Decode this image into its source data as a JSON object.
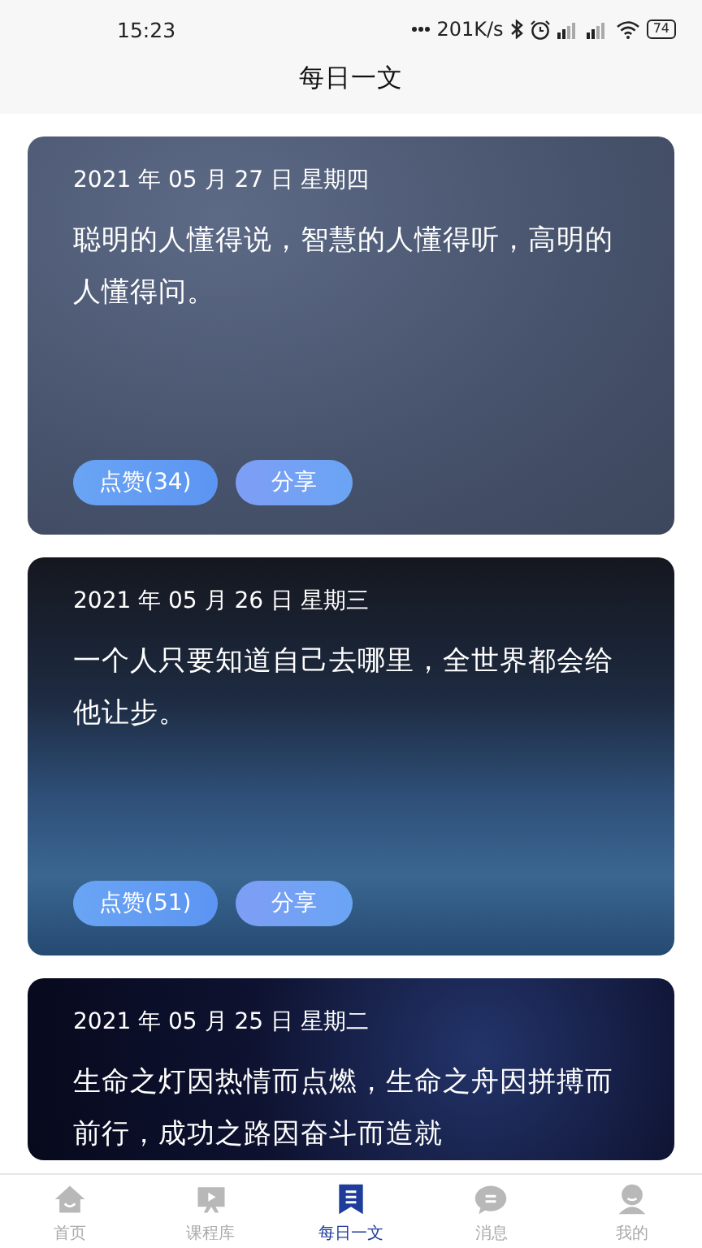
{
  "status_bar": {
    "time": "15:23",
    "speed": "201K/s",
    "battery": "74"
  },
  "header": {
    "title": "每日一文"
  },
  "cards": [
    {
      "date": "2021 年 05 月 27 日 星期四",
      "text": "聪明的人懂得说，智慧的人懂得听，高明的人懂得问。",
      "like": "点赞(34)",
      "share": "分享"
    },
    {
      "date": "2021 年 05 月 26 日 星期三",
      "text": "一个人只要知道自己去哪里，全世界都会给他让步。",
      "like": "点赞(51)",
      "share": "分享"
    },
    {
      "date": "2021 年 05 月 25 日 星期二",
      "text": "生命之灯因热情而点燃，生命之舟因拼搏而前行，成功之路因奋斗而造就"
    }
  ],
  "tab_bar": [
    {
      "label": "首页",
      "selected": false
    },
    {
      "label": "课程库",
      "selected": false
    },
    {
      "label": "每日一文",
      "selected": true
    },
    {
      "label": "消息",
      "selected": false
    },
    {
      "label": "我的",
      "selected": false
    }
  ]
}
